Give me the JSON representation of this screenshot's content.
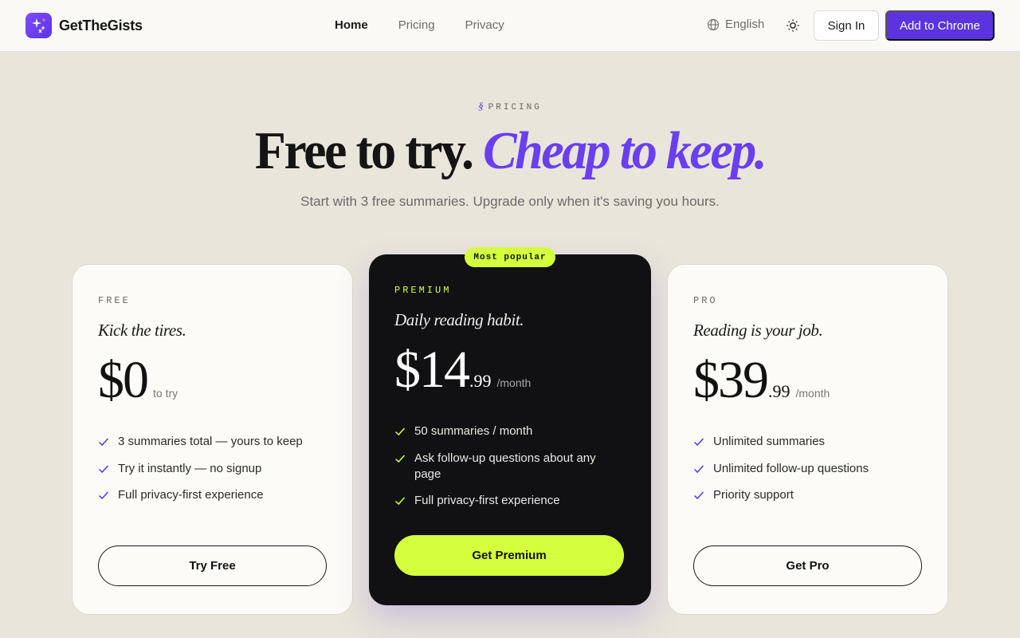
{
  "header": {
    "brand_name": "GetTheGists",
    "nav": [
      {
        "label": "Home",
        "active": true
      },
      {
        "label": "Pricing",
        "active": false
      },
      {
        "label": "Privacy",
        "active": false
      }
    ],
    "language": "English",
    "sign_in": "Sign In",
    "cta": "Add to Chrome",
    "accent_color": "#5b34e0"
  },
  "hero": {
    "eyebrow_mark": "§",
    "eyebrow": "PRICING",
    "headline_plain": "Free to try.",
    "headline_accent": "Cheap to keep.",
    "subline": "Start with 3 free summaries. Upgrade only when it's saving you hours."
  },
  "plans": {
    "free": {
      "tier": "FREE",
      "tagline": "Kick the tires.",
      "price": "$0",
      "cents": "",
      "per": "to try",
      "features": [
        "3 summaries total — yours to keep",
        "Try it instantly — no signup",
        "Full privacy-first experience"
      ],
      "cta": "Try Free"
    },
    "premium": {
      "badge": "Most popular",
      "tier": "PREMIUM",
      "tagline": "Daily reading habit.",
      "price": "$14",
      "cents": ".99",
      "per": "/month",
      "features": [
        "50 summaries / month",
        "Ask follow-up questions about any page",
        "Full privacy-first experience"
      ],
      "cta": "Get Premium",
      "highlight_color": "#d4ff3c"
    },
    "pro": {
      "tier": "PRO",
      "tagline": "Reading is your job.",
      "price": "$39",
      "cents": ".99",
      "per": "/month",
      "features": [
        "Unlimited summaries",
        "Unlimited follow-up questions",
        "Priority support"
      ],
      "cta": "Get Pro"
    }
  }
}
